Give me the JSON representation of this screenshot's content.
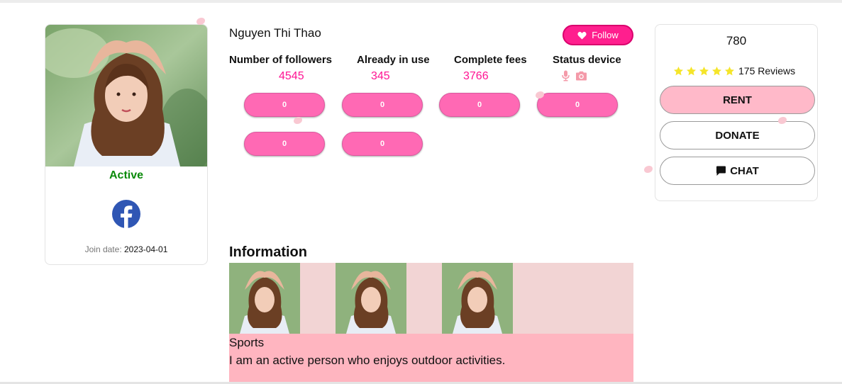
{
  "profile": {
    "name": "Nguyen Thi Thao",
    "status": "Active",
    "join_label": "Join date:",
    "join_date": "2023-04-01",
    "social_icon": "facebook-icon"
  },
  "follow": {
    "label": "Follow",
    "icon": "heart-icon"
  },
  "stats": {
    "headers": [
      "Number of followers",
      "Already in use",
      "Complete fees",
      "Status device"
    ],
    "values": [
      "4545",
      "345",
      "3766"
    ],
    "device_icons": [
      "microphone-icon",
      "camera-icon"
    ]
  },
  "pills": [
    "0",
    "0",
    "0",
    "0",
    "0",
    "0"
  ],
  "information": {
    "title": "Information",
    "category": "Sports",
    "description": "I am an active person who enjoys outdoor activities."
  },
  "rent_card": {
    "price": "780",
    "stars": 5,
    "reviews": "175 Reviews",
    "rent_label": "RENT",
    "donate_label": "DONATE",
    "chat_label": "CHAT"
  },
  "colors": {
    "accent": "#ff1f8e",
    "pill": "#ff69b4",
    "active": "#0a8a0a",
    "star": "#f5e52a",
    "rent": "#ffb9c9"
  }
}
